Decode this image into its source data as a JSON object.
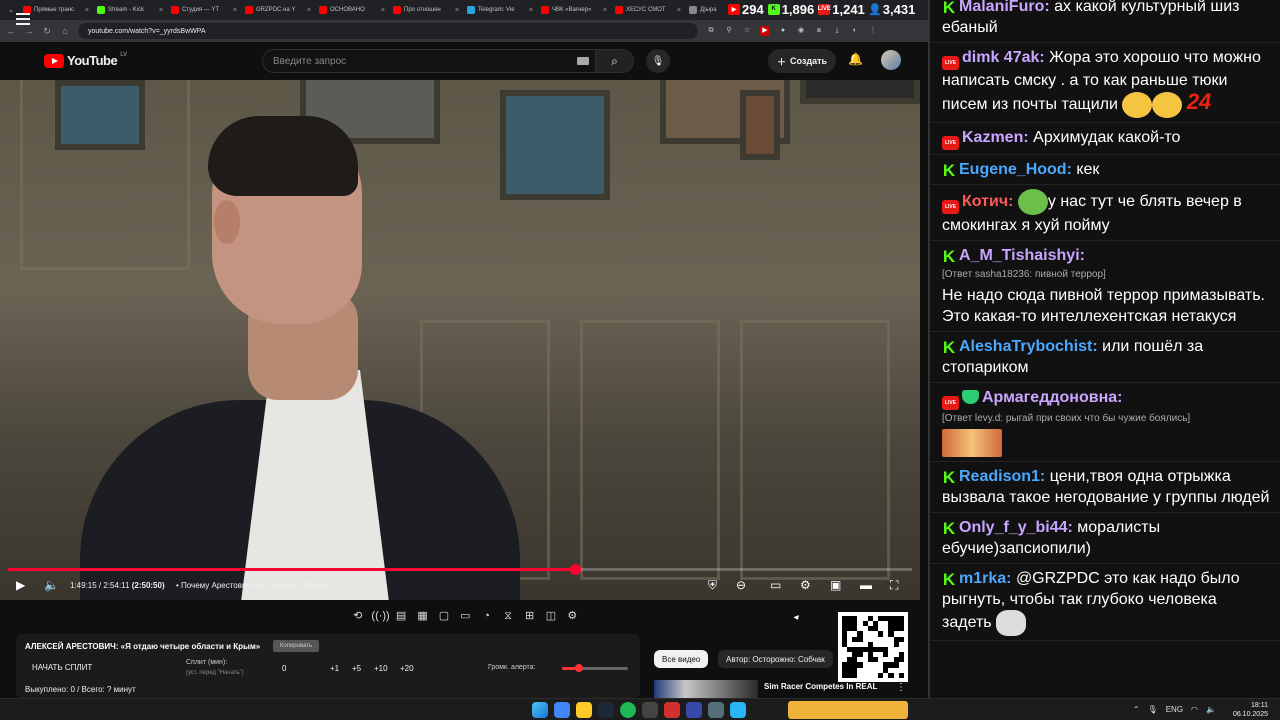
{
  "browser": {
    "tabs": [
      {
        "label": "Прямые транс",
        "color": "#ff0000"
      },
      {
        "label": "Stream - Kick",
        "color": "#53fc18"
      },
      {
        "label": "Студия — YT",
        "color": "#ff0000"
      },
      {
        "label": "GRZPDC на Y",
        "color": "#ff0000"
      },
      {
        "label": "ОСНОВАНО",
        "color": "#ff0000"
      },
      {
        "label": "Про отношен",
        "color": "#ff0000"
      },
      {
        "label": "Telegram: Vie",
        "color": "#2aa3de"
      },
      {
        "label": "ЧВК «Вагнер»",
        "color": "#ff0000"
      },
      {
        "label": "ХЕСУС СМОТ",
        "color": "#ff0000"
      },
      {
        "label": "Д|ыра",
        "color": "#888888"
      }
    ],
    "stream_stats": {
      "youtube_viewers": "294",
      "kick_viewers": "1,896",
      "live_viewers": "1,241",
      "total_viewers": "3,431"
    },
    "url": "youtube.com/watch?v=_yyrdsBwWPA"
  },
  "youtube": {
    "logo_text": "YouTube",
    "country_code": "LV",
    "search_placeholder": "Введите запрос",
    "create_label": "Создать"
  },
  "player": {
    "current_time": "1:49:15",
    "duration": "2:54:11",
    "remaining": "(2:50:50)",
    "chapter": "Почему Арестович стал хвалить Путина?",
    "progress_fraction": 0.627
  },
  "split_panel": {
    "title": "АЛЕКСЕЙ АРЕСТОВИЧ: «Я отдаю четыре области и Крым»",
    "copy_label": "Копировать",
    "start_label": "НАЧАТЬ СПЛИТ",
    "split_label": "Сплит (мин):",
    "split_hint": "(уст. перед \"Начать\")",
    "split_value": "0",
    "increments": [
      "+1",
      "+5",
      "+10",
      "+20"
    ],
    "alert_label": "Громк. алерта:",
    "alert_volume_fraction": 0.25,
    "status": "Выкуплено: 0 / Всего: ? минут"
  },
  "recommendations": {
    "chip_all": "Все видео",
    "chip_author": "Автор: Осторожно: Собчак",
    "first_title": "Sim Racer Competes In REAL"
  },
  "chat": {
    "messages": [
      {
        "platform": "kick",
        "nick": "MalaniFuro:",
        "nick_color": "#c9a6ff",
        "text": "ах какой культурный шиз ебаный",
        "reply": ""
      },
      {
        "platform": "live",
        "nick": "dimk 47ak:",
        "nick_color": "#c9a6ff",
        "text": "Жора это хорошо что можно написать смску . а то как раньше тюки писем из почты тащили",
        "reply": "",
        "extra": "24"
      },
      {
        "platform": "live",
        "nick": "Kazmen:",
        "nick_color": "#c9a6ff",
        "text": "Архимудак какой-то",
        "reply": ""
      },
      {
        "platform": "kick",
        "nick": "Eugene_Hood:",
        "nick_color": "#4aa8ff",
        "text": "кек",
        "reply": ""
      },
      {
        "platform": "live",
        "nick": "Котич:",
        "nick_color": "#ff5a5a",
        "text": "у нас тут че блять вечер в смокингах я хуй пойму",
        "reply": ""
      },
      {
        "platform": "kick",
        "nick": "A_M_Tishaishyi:",
        "nick_color": "#c9a6ff",
        "text": "Не надо сюда пивной террор примазывать. Это какая-то интеллехентская нетакуся",
        "reply": "[Ответ sasha18236: пивной террор]"
      },
      {
        "platform": "kick",
        "nick": "AleshaTrybochist:",
        "nick_color": "#4aa8ff",
        "text": "или пошёл за стопариком",
        "reply": ""
      },
      {
        "platform": "live",
        "nick": "Армагеддоновна:",
        "nick_color": "#c9a6ff",
        "text": "",
        "reply": "[Ответ levy.d: рыгай при своих что бы чужие боялись]"
      },
      {
        "platform": "kick",
        "nick": "Readison1:",
        "nick_color": "#4aa8ff",
        "text": "цени,твоя одна отрыжка вызвала такое негодование у группы людей",
        "reply": ""
      },
      {
        "platform": "kick",
        "nick": "Only_f_y_bi44:",
        "nick_color": "#c9a6ff",
        "text": "моралисты ебучие)запсиопили)",
        "reply": ""
      },
      {
        "platform": "kick",
        "nick": "m1rka:",
        "nick_color": "#4aa8ff",
        "text": "@GRZPDC это как надо было рыгнуть, чтобы так глубоко человека задеть",
        "reply": ""
      }
    ]
  },
  "taskbar": {
    "language": "ENG",
    "time": "18:11",
    "date": "06.10.2025"
  }
}
